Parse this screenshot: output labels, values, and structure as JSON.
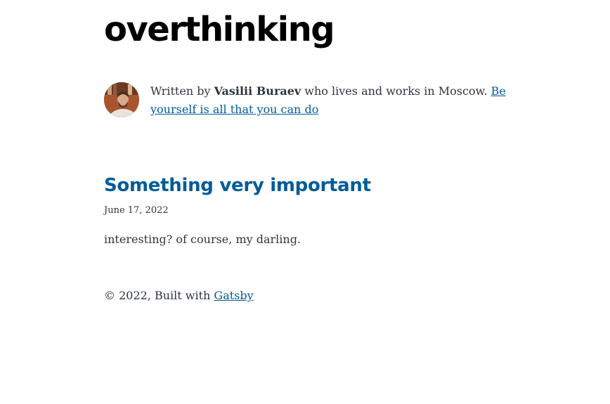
{
  "site": {
    "title": "overthinking"
  },
  "bio": {
    "prefix": "Written by ",
    "author": "Vasilii Buraev",
    "middle": " who lives and works in Moscow. ",
    "link_text": "Be yourself is all that you can do"
  },
  "posts": [
    {
      "title": "Something very important",
      "date": "June 17, 2022",
      "description": "interesting? of course, my darling."
    }
  ],
  "footer": {
    "prefix": "© 2022, Built with ",
    "link_text": "Gatsby"
  },
  "colors": {
    "link": "#005b99",
    "text": "#2e353f",
    "title": "#000000"
  }
}
